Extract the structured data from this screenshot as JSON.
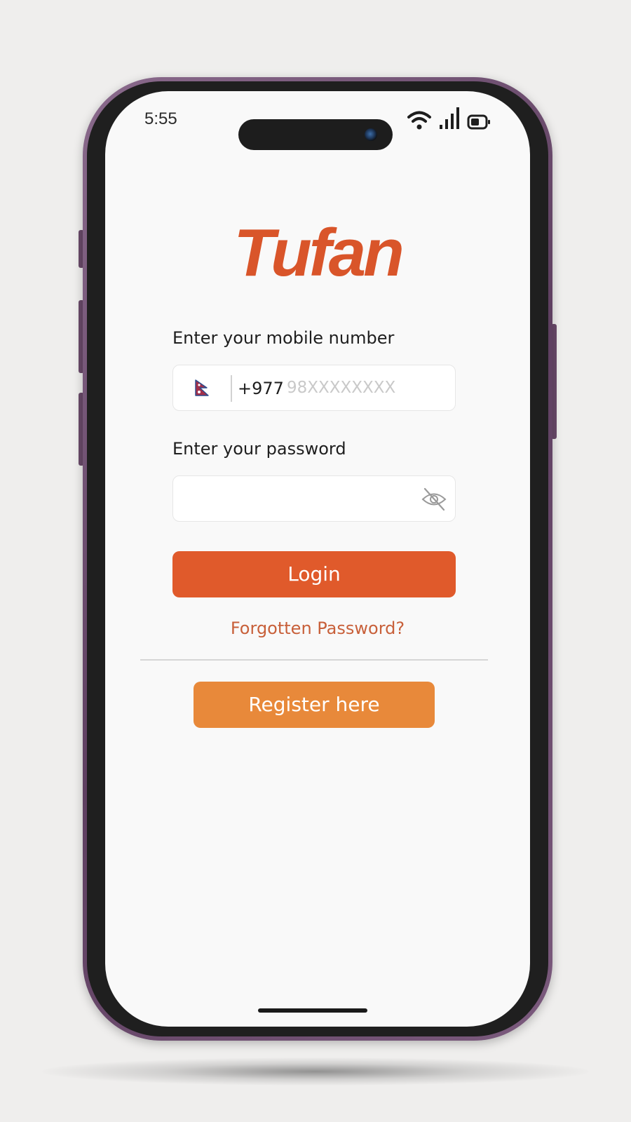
{
  "status_bar": {
    "time": "5:55",
    "icons": [
      "wifi-icon",
      "signal-icon",
      "battery-icon"
    ]
  },
  "app": {
    "logo_text": "Tufan",
    "brand_color": "#d9552a"
  },
  "login_form": {
    "mobile_label": "Enter your mobile number",
    "country_flag": "nepal-flag-icon",
    "country_code": "+977",
    "mobile_value": "",
    "mobile_placeholder": "98XXXXXXXX",
    "password_label": "Enter your password",
    "password_value": "",
    "password_toggle_icon": "eye-off-icon",
    "login_button": "Login",
    "login_button_color": "#e05a2b",
    "forgot_link": "Forgotten Password?",
    "register_button": "Register here",
    "register_button_color": "#e8893a"
  }
}
